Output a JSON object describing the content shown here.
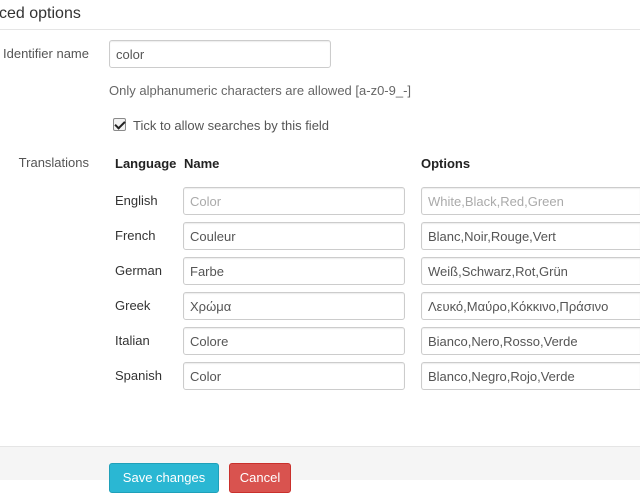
{
  "panel": {
    "title": "ced options"
  },
  "identifier": {
    "label": "Identifier name",
    "value": "color",
    "help": "Only alphanumeric characters are allowed [a-z0-9_-]"
  },
  "searchable": {
    "label": "Tick to allow searches by this field",
    "checked": true
  },
  "translations": {
    "label": "Translations",
    "headers": {
      "language": "Language",
      "name": "Name",
      "options": "Options"
    },
    "rows": [
      {
        "language": "English",
        "name": "",
        "name_placeholder": "Color",
        "options": "",
        "options_placeholder": "White,Black,Red,Green"
      },
      {
        "language": "French",
        "name": "Couleur",
        "options": "Blanc,Noir,Rouge,Vert"
      },
      {
        "language": "German",
        "name": "Farbe",
        "options": "Weiß,Schwarz,Rot,Grün"
      },
      {
        "language": "Greek",
        "name": "Χρώμα",
        "options": "Λευκό,Μαύρο,Κόκκινο,Πράσινο"
      },
      {
        "language": "Italian",
        "name": "Colore",
        "options": "Bianco,Nero,Rosso,Verde"
      },
      {
        "language": "Spanish",
        "name": "Color",
        "options": "Blanco,Negro,Rojo,Verde"
      }
    ]
  },
  "actions": {
    "save": "Save changes",
    "cancel": "Cancel"
  },
  "colors": {
    "primary": "#2ab7d3",
    "danger": "#d9534f"
  }
}
